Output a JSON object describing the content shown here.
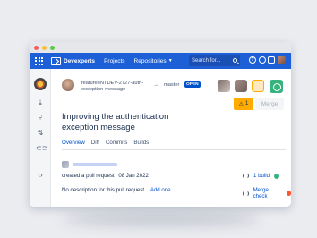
{
  "colors": {
    "nav_bg": "#1d5fd6",
    "accent": "#0052cc",
    "warning": "#ffab00",
    "success": "#36b37e",
    "error": "#ff5630"
  },
  "topnav": {
    "brand": "Devexperts",
    "projects": "Projects",
    "repositories": "Repositories",
    "search_placeholder": "Search for...",
    "help_icon_glyph": "?"
  },
  "sidebar": {
    "icons": [
      "avatar-icon",
      "inbox-icon",
      "pull-request-icon",
      "branches-icon",
      "link-icon",
      "collapse-icon"
    ]
  },
  "pull_request": {
    "source_branch": "feature/INTDEV-2727-auth-exception-message",
    "arrow": "→",
    "target_branch": "master",
    "state_badge": "OPEN",
    "title": "Improving the authentication exception message",
    "warning_count": "1",
    "merge_label": "Merge",
    "more_label": "•••"
  },
  "tabs": [
    "Overview",
    "Diff",
    "Commits",
    "Builds"
  ],
  "overview": {
    "created_text": "created a pull request",
    "created_date": "08 Jan 2022",
    "description_text": "No description for this pull request.",
    "add_one_label": "Add one",
    "build_label": "1 build",
    "merge_check_label": "Merge check"
  }
}
